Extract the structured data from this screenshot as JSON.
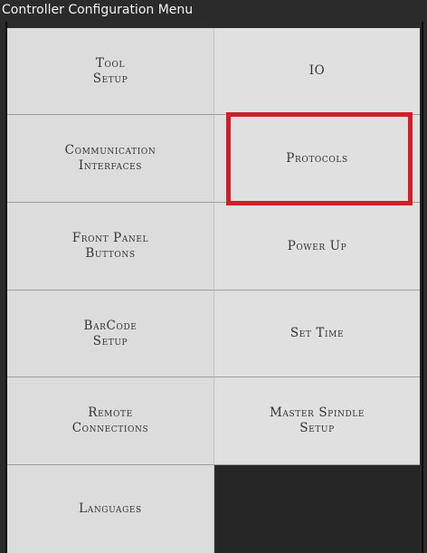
{
  "window": {
    "title": "Controller Configuration Menu"
  },
  "menu": {
    "tool_setup": "Tool\nSetup",
    "io": "IO",
    "communication_interfaces": "Communication\nInterfaces",
    "protocols": "Protocols",
    "front_panel_buttons": "Front Panel\nButtons",
    "power_up": "Power Up",
    "barcode_setup": "BarCode\nSetup",
    "set_time": "Set Time",
    "remote_connections": "Remote\nConnections",
    "master_spindle_setup": "Master Spindle\nSetup",
    "languages": "Languages"
  },
  "highlight": {
    "target": "protocols",
    "color": "#d01f2b"
  },
  "colors": {
    "background": "#2b2b2b",
    "tile": "#dcdcdc",
    "text": "#333333"
  }
}
